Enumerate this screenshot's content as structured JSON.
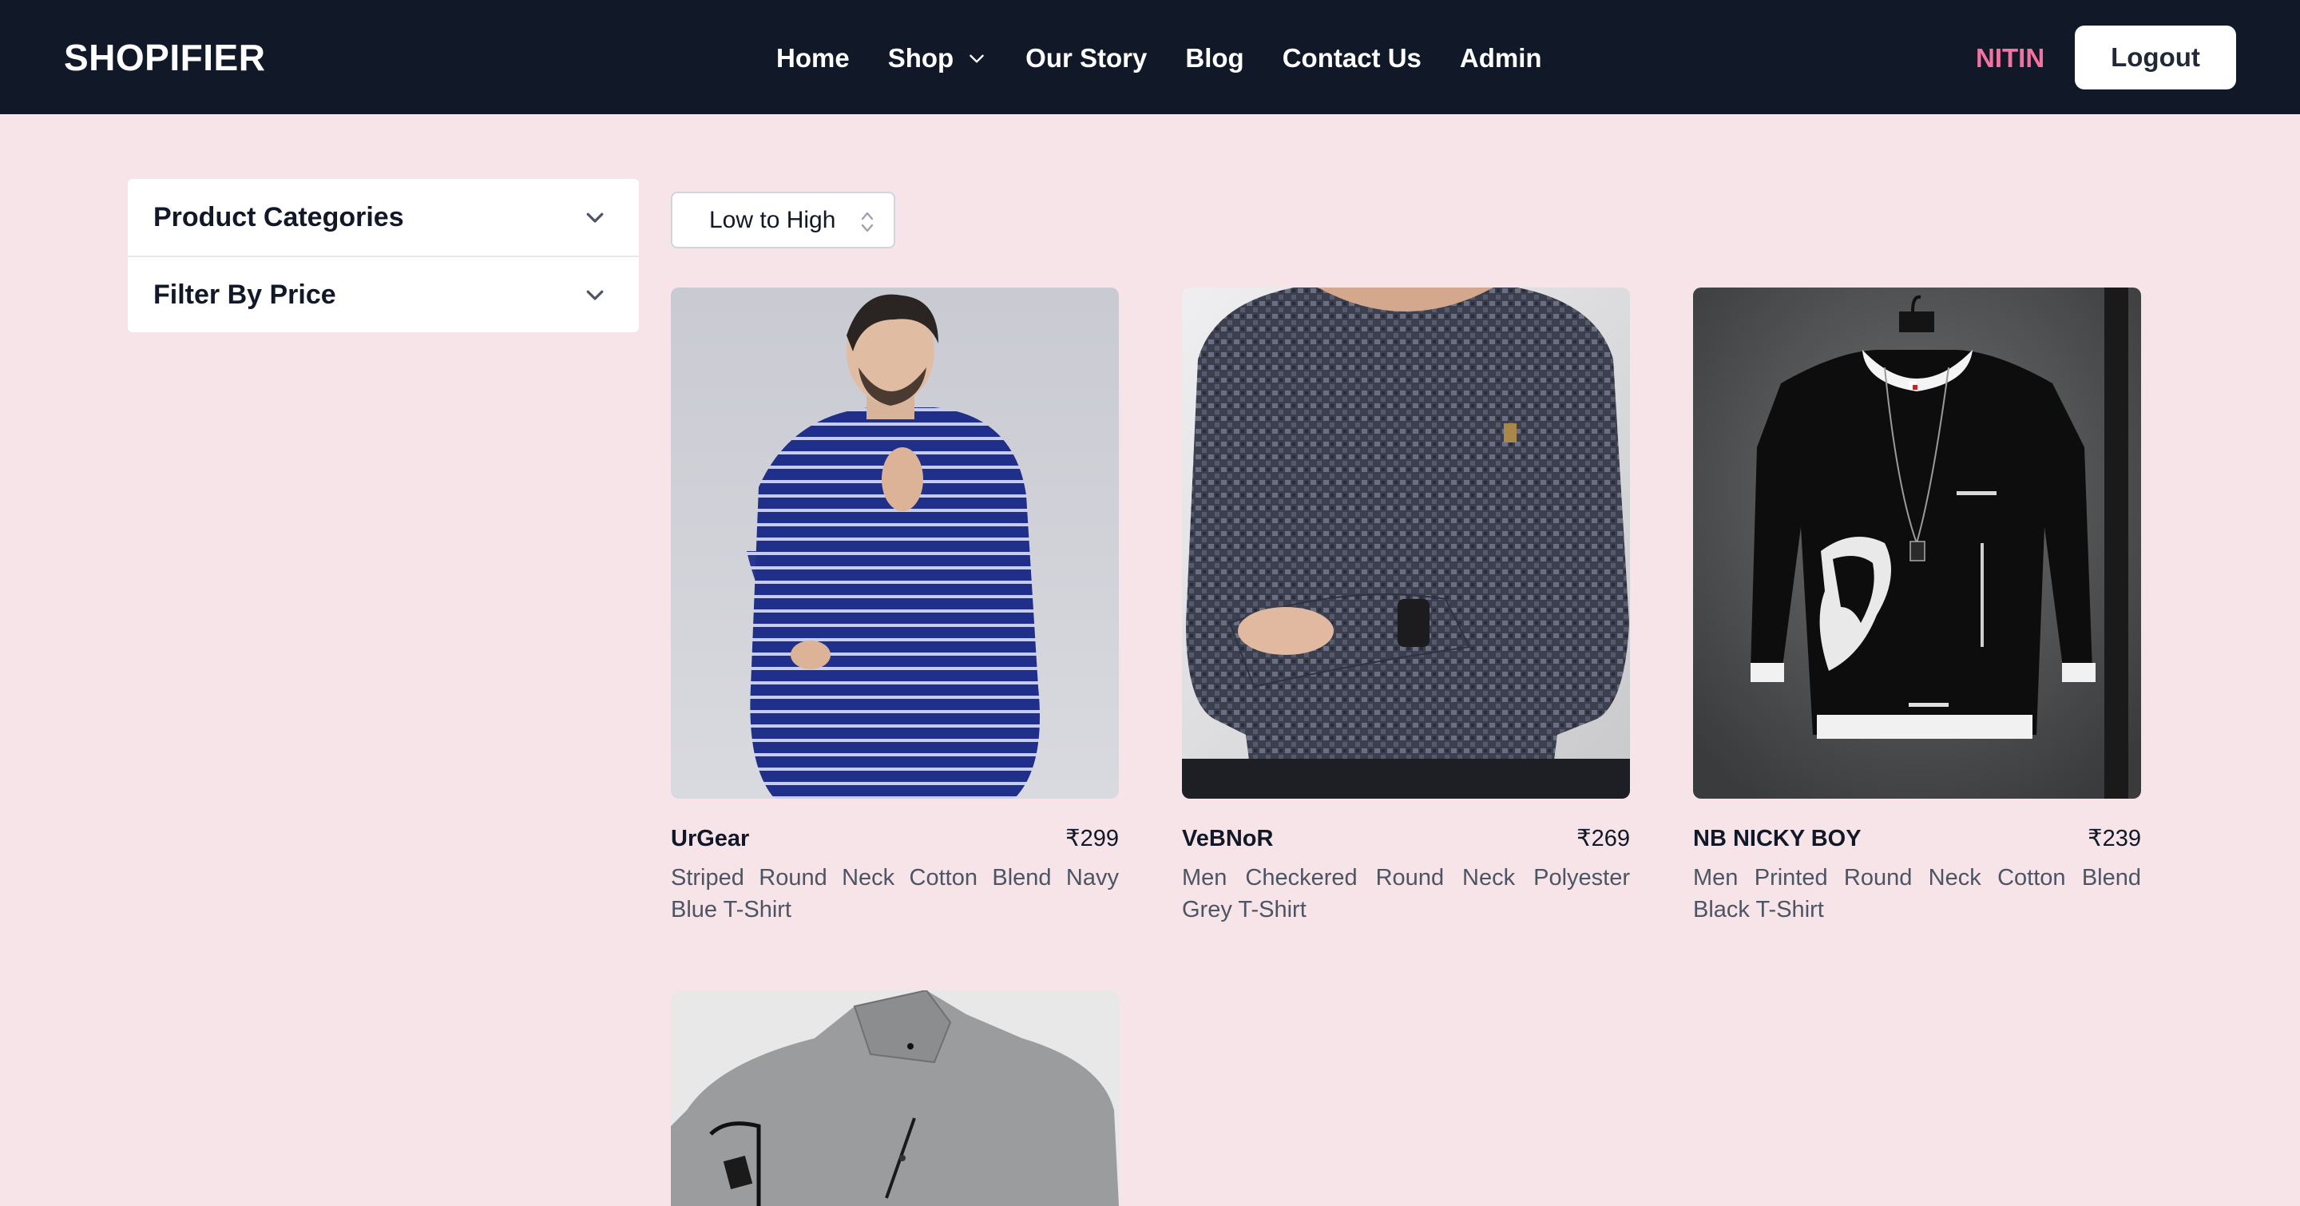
{
  "navbar": {
    "brand": "SHOPIFIER",
    "links": [
      "Home",
      "Shop",
      "Our Story",
      "Blog",
      "Contact Us",
      "Admin"
    ],
    "user": "NITIN",
    "logout_label": "Logout",
    "colors": {
      "background": "#111827",
      "user_accent": "#f472a0"
    }
  },
  "sidebar": {
    "sections": [
      "Product Categories",
      "Filter By Price"
    ]
  },
  "sort": {
    "selected": "Low to High"
  },
  "products": [
    {
      "brand": "UrGear",
      "price": "₹299",
      "description": "Striped Round Neck Cotton Blend Navy Blue T-Shirt",
      "image": "navy-striped-tshirt"
    },
    {
      "brand": "VeBNoR",
      "price": "₹269",
      "description": "Men Checkered Round Neck Polyester Grey T-Shirt",
      "image": "grey-checkered-tshirt"
    },
    {
      "brand": "NB NICKY BOY",
      "price": "₹239",
      "description": "Men Printed Round Neck Cotton Blend Black T-Shirt",
      "image": "black-printed-sweatshirt"
    },
    {
      "image": "grey-jacket"
    }
  ],
  "page": {
    "background": "#f7e4e8"
  }
}
